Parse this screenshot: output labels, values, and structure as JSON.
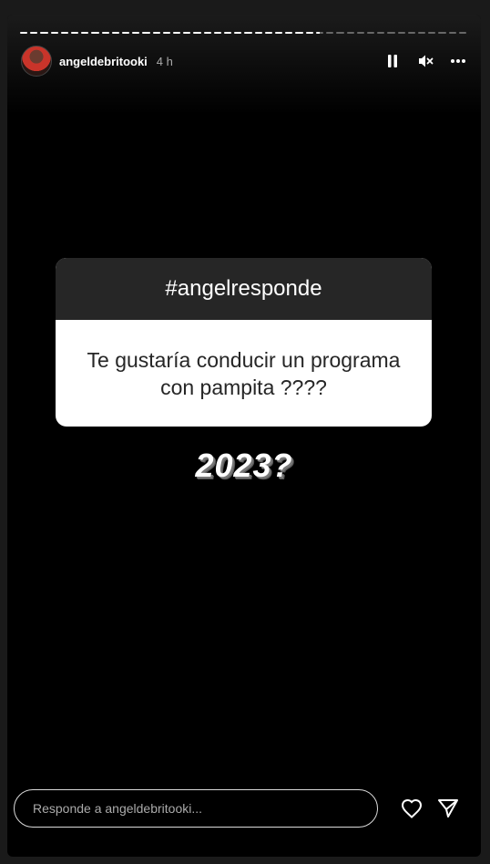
{
  "story": {
    "username": "angeldebritooki",
    "time_ago": "4 h",
    "progress": [
      1,
      1,
      1,
      1,
      1,
      1,
      1,
      1,
      1,
      1,
      1,
      1,
      1,
      1,
      1,
      1,
      1,
      1,
      1,
      1,
      1,
      1,
      1,
      1,
      1,
      1,
      1,
      1,
      1,
      0.5,
      0,
      0,
      0,
      0,
      0,
      0,
      0,
      0,
      0,
      0,
      0,
      0,
      0,
      0
    ]
  },
  "controls": {
    "pause_icon": "pause-icon",
    "mute_icon": "speaker-muted-icon",
    "more_icon": "more-horizontal-icon"
  },
  "question": {
    "header": "#angelresponde",
    "text": "Te gustaría conducir un programa con pampita ????"
  },
  "overlay_text": "2023?",
  "footer": {
    "reply_placeholder": "Responde a angeldebritooki..."
  },
  "colors": {
    "background": "#000000",
    "question_header": "#262626",
    "question_body": "#ffffff"
  }
}
